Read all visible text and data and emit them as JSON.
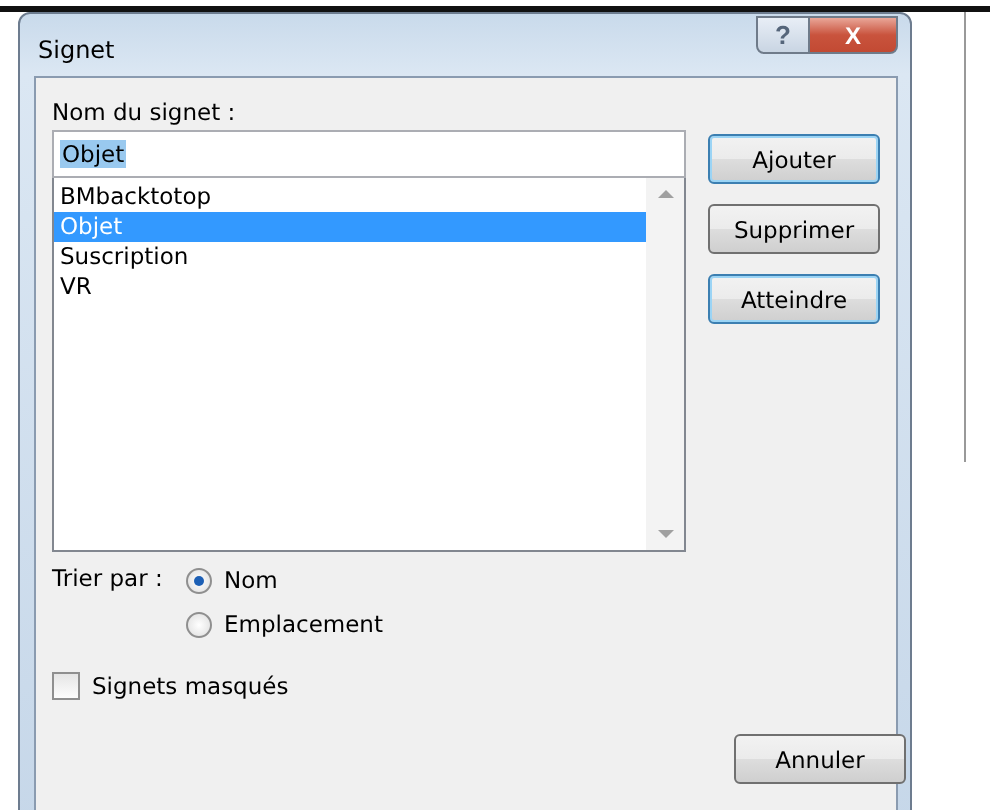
{
  "window": {
    "title": "Signet",
    "controls": [
      {
        "kind": "help",
        "label": "?"
      },
      {
        "kind": "close",
        "label": "X"
      }
    ]
  },
  "name_field": {
    "label": "Nom du signet :",
    "value": "Objet",
    "text_selected": true
  },
  "bookmarks": [
    {
      "label": "BMbacktotop",
      "selected": false
    },
    {
      "label": "Objet",
      "selected": true
    },
    {
      "label": "Suscription",
      "selected": false
    },
    {
      "label": "VR",
      "selected": false
    }
  ],
  "buttons": [
    {
      "label": "Ajouter",
      "highlighted": true
    },
    {
      "label": "Supprimer",
      "highlighted": false
    },
    {
      "label": "Atteindre",
      "highlighted": true
    }
  ],
  "sort": {
    "label": "Trier par :",
    "options": [
      {
        "label": "Nom",
        "selected": true
      },
      {
        "label": "Emplacement",
        "selected": false
      }
    ]
  },
  "hidden_bookmarks": {
    "label": "Signets masqués",
    "checked": false
  },
  "cancel_button": {
    "label": "Annuler",
    "highlighted": false
  }
}
